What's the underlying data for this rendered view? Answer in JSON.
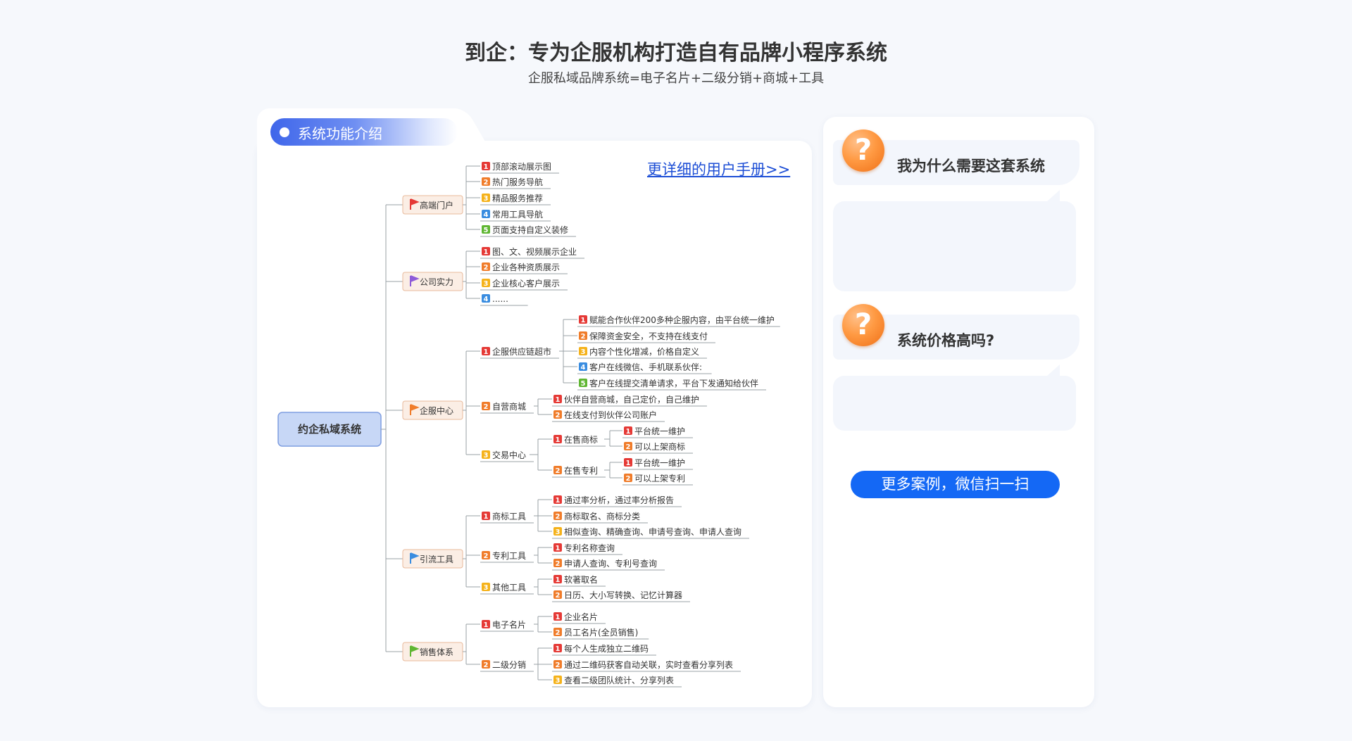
{
  "header": {
    "title": "到企：专为企服机构打造自有品牌小程序系统",
    "subtitle": "企服私域品牌系统=电子名片+二级分销+商城+工具"
  },
  "left_panel": {
    "tab_label": "系统功能介绍",
    "manual_link": "更详细的用户手册>>"
  },
  "right_panel": {
    "q1": "我为什么需要这套系统",
    "q2": "系统价格高吗?",
    "cases_button": "更多案例，微信扫一扫",
    "icon": "question-mark-icon"
  },
  "colors": {
    "accent_blue": "#1468f5",
    "badge_red": "#e53935",
    "badge_orange": "#f07c2a",
    "badge_yellow": "#f5b21a",
    "badge_blue": "#3a8de0",
    "badge_green": "#5fb632"
  },
  "mindmap": {
    "root": "约企私域系统",
    "branches": [
      {
        "label": "高端门户",
        "flag": "#e53935",
        "items": [
          "顶部滚动展示图",
          "热门服务导航",
          "精品服务推荐",
          "常用工具导航",
          "页面支持自定义装修"
        ]
      },
      {
        "label": "公司实力",
        "flag": "#8e5bd9",
        "items": [
          "图、文、视频展示企业",
          "企业各种资质展示",
          "企业核心客户展示",
          "......"
        ]
      },
      {
        "label": "企服中心",
        "flag": "#f07c2a",
        "groups": [
          {
            "label": "企服供应链超市",
            "items": [
              "赋能合作伙伴200多种企服内容，由平台统一维护",
              "保障资金安全，不支持在线支付",
              "内容个性化增减，价格自定义",
              "客户在线微信、手机联系伙伴:",
              "客户在线提交清单请求，平台下发通知给伙伴"
            ]
          },
          {
            "label": "自营商城",
            "items": [
              "伙伴自营商城，自己定价，自己维护",
              "在线支付到伙伴公司账户"
            ]
          },
          {
            "label": "交易中心",
            "subgroups": [
              {
                "label": "在售商标",
                "items": [
                  "平台统一维护",
                  "可以上架商标"
                ]
              },
              {
                "label": "在售专利",
                "items": [
                  "平台统一维护",
                  "可以上架专利"
                ]
              }
            ]
          }
        ]
      },
      {
        "label": "引流工具",
        "flag": "#3a8de0",
        "groups": [
          {
            "label": "商标工具",
            "items": [
              "通过率分析，通过率分析报告",
              "商标取名、商标分类",
              "相似查询、精确查询、申请号查询、申请人查询"
            ]
          },
          {
            "label": "专利工具",
            "items": [
              "专利名称查询",
              "申请人查询、专利号查询"
            ]
          },
          {
            "label": "其他工具",
            "items": [
              "软著取名",
              "日历、大小写转换、记忆计算器"
            ]
          }
        ]
      },
      {
        "label": "销售体系",
        "flag": "#5fb632",
        "groups": [
          {
            "label": "电子名片",
            "items": [
              "企业名片",
              "员工名片(全员销售)"
            ]
          },
          {
            "label": "二级分销",
            "items": [
              "每个人生成独立二维码",
              "通过二维码获客自动关联，实时查看分享列表",
              "查看二级团队统计、分享列表"
            ]
          }
        ]
      }
    ]
  }
}
